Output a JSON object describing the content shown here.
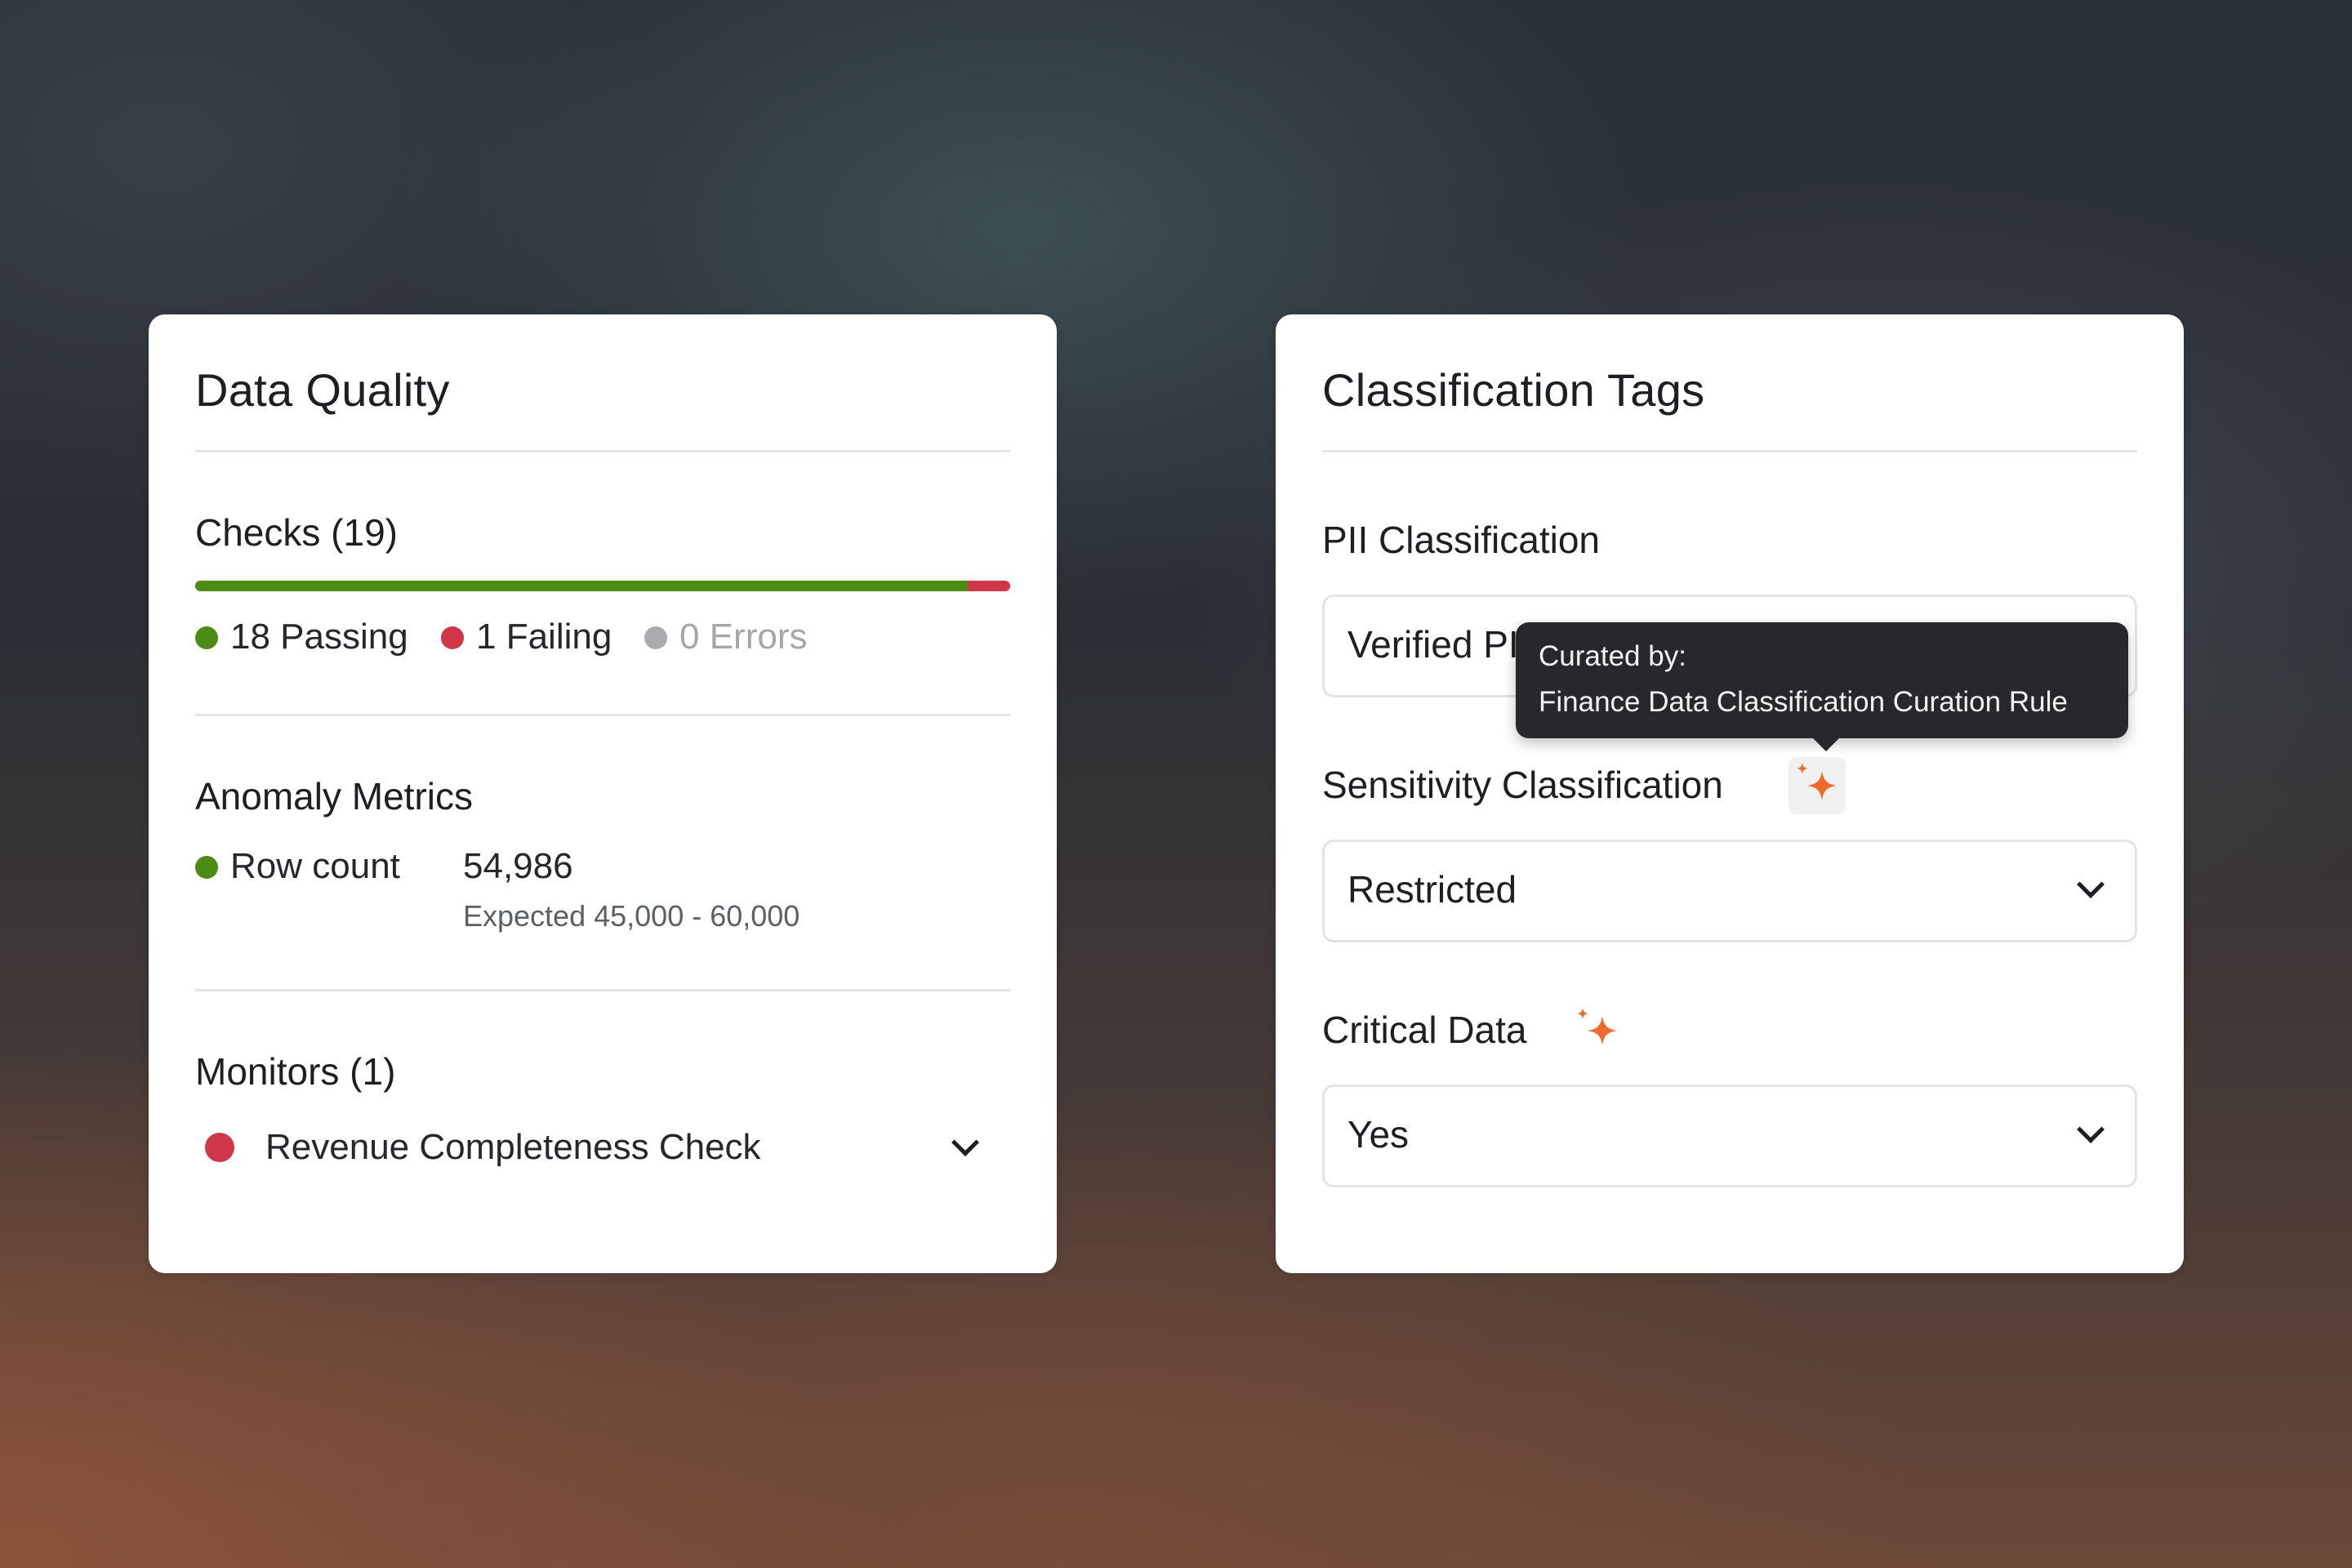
{
  "data_quality": {
    "title": "Data Quality",
    "checks": {
      "title": "Checks (19)",
      "passing_fraction": 0.9474,
      "passing_label": "18 Passing",
      "failing_label": "1 Failing",
      "errors_label": "0 Errors"
    },
    "anomaly": {
      "title": "Anomaly Metrics",
      "metric_label": "Row count",
      "metric_value": "54,986",
      "expected": "Expected 45,000 - 60,000"
    },
    "monitors": {
      "title": "Monitors (1)",
      "items": [
        {
          "label": "Revenue Completeness Check",
          "status": "failing"
        }
      ]
    }
  },
  "classification": {
    "title": "Classification Tags",
    "pii": {
      "label": "PII Classification",
      "value": "Verified PII"
    },
    "sensitivity": {
      "label": "Sensitivity Classification",
      "value": "Restricted"
    },
    "critical": {
      "label": "Critical Data",
      "value": "Yes"
    }
  },
  "tooltip": {
    "line1": "Curated by:",
    "line2": "Finance Data Classification Curation Rule"
  },
  "colors": {
    "passing": "#4c8c16",
    "failing": "#cf3647",
    "errors": "#a9abae",
    "sparkle": "#ee6a2a"
  },
  "icons": {
    "curated": "sparkle-icon",
    "dropdown": "chevron-down-icon"
  }
}
